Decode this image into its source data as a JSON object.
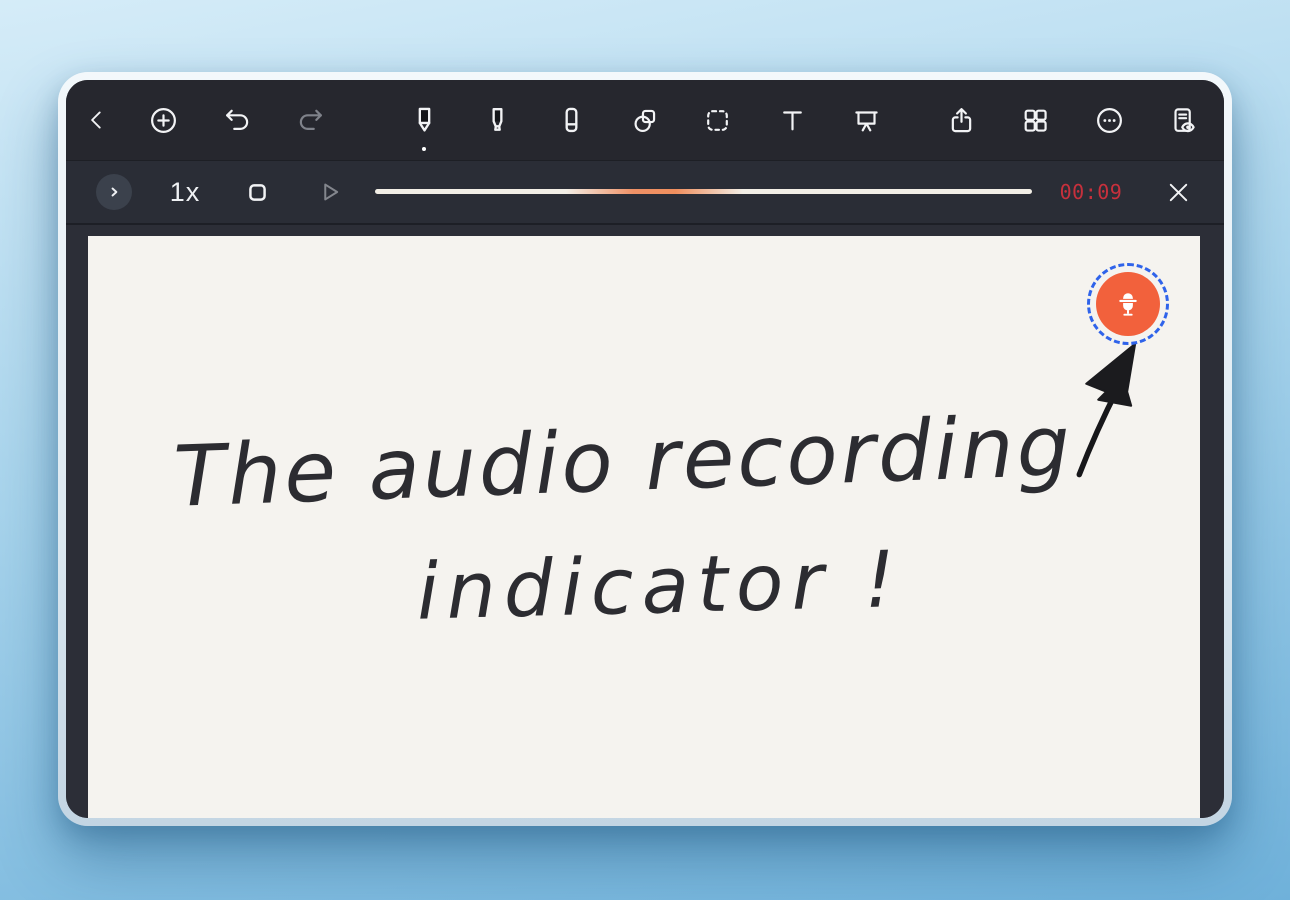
{
  "window": {
    "background_gradient": [
      "#d5ecf8",
      "#6fb1da"
    ],
    "frame_color": "#e6eff5",
    "app_background": "#2c2e37"
  },
  "toolbar": {
    "items": [
      {
        "name": "back",
        "icon": "chevron-left-icon"
      },
      {
        "name": "add",
        "icon": "plus-circle-icon"
      },
      {
        "name": "undo",
        "icon": "undo-icon",
        "state": "enabled"
      },
      {
        "name": "redo",
        "icon": "redo-icon",
        "state": "disabled"
      },
      {
        "name": "pen",
        "icon": "pen-icon",
        "state": "selected"
      },
      {
        "name": "highlighter",
        "icon": "highlighter-icon"
      },
      {
        "name": "eraser",
        "icon": "eraser-icon"
      },
      {
        "name": "shapes",
        "icon": "shapes-icon"
      },
      {
        "name": "selection",
        "icon": "marquee-selection-icon"
      },
      {
        "name": "text",
        "icon": "text-tool-icon"
      },
      {
        "name": "presenter",
        "icon": "presentation-icon"
      },
      {
        "name": "share",
        "icon": "share-icon"
      },
      {
        "name": "pages",
        "icon": "grid-icon"
      },
      {
        "name": "more",
        "icon": "ellipsis-circle-icon"
      },
      {
        "name": "page-preview",
        "icon": "document-eye-icon"
      }
    ]
  },
  "playback_bar": {
    "collapse_icon": "chevron-right-icon",
    "speed_label": "1x",
    "stop_icon": "stop-icon",
    "play_icon": "play-icon",
    "elapsed_time": "00:09",
    "timer_color": "#c7303c",
    "close_icon": "close-icon",
    "progress_track_color": "#f2eee6",
    "recorded_segment_color": "#ef9166"
  },
  "canvas": {
    "background_color": "#f5f3ef",
    "ink_color": "#2c2c31",
    "handwriting_lines": [
      "The audio recording",
      "indicator !"
    ]
  },
  "recording_indicator": {
    "icon": "microphone-icon",
    "button_color": "#f2613c",
    "ring_color": "#2f63ea"
  }
}
